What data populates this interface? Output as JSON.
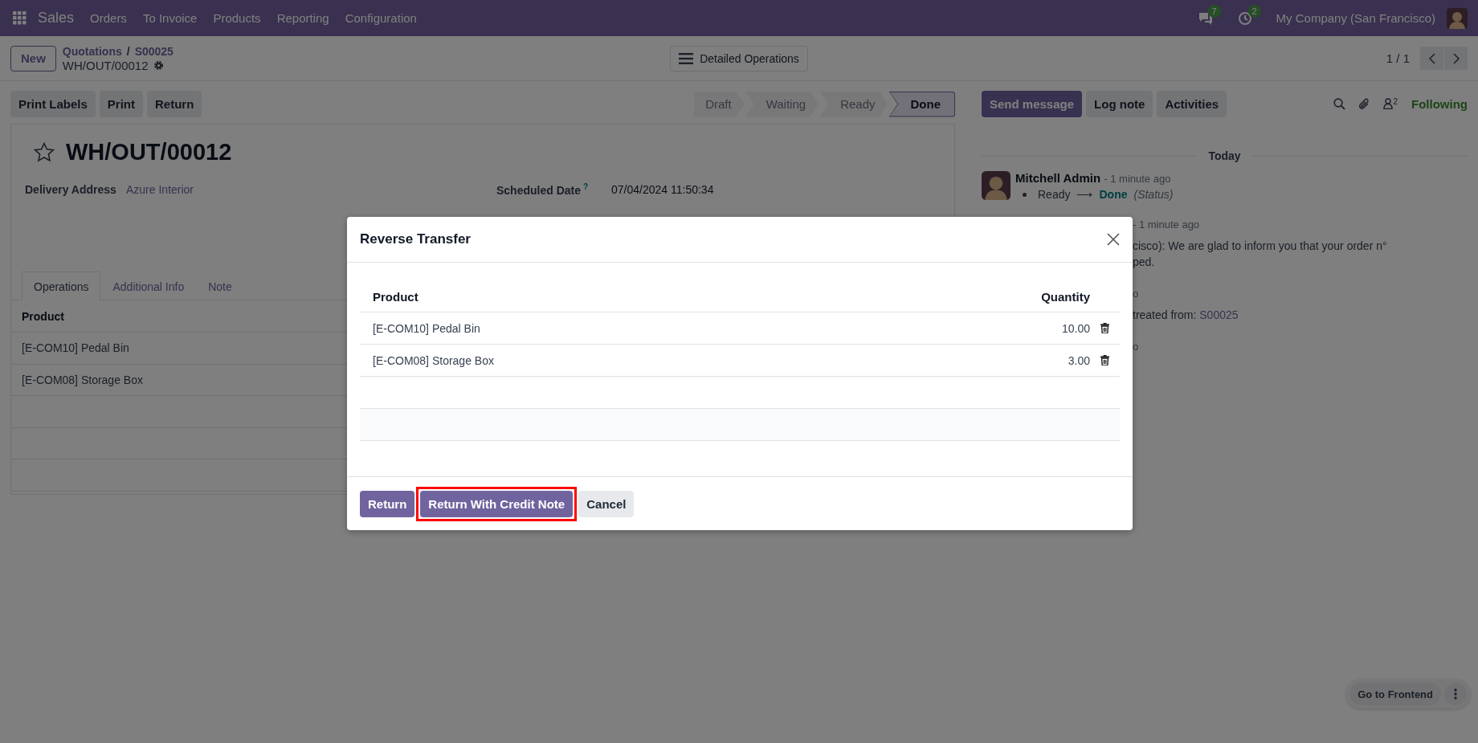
{
  "navbar": {
    "app": "Sales",
    "menu": [
      "Orders",
      "To Invoice",
      "Products",
      "Reporting",
      "Configuration"
    ],
    "messages_badge": "7",
    "activities_badge": "2",
    "company": "My Company (San Francisco)"
  },
  "control_panel": {
    "new_button": "New",
    "breadcrumbs": [
      "Quotations",
      "S00025"
    ],
    "breadcrumb_separator": "/",
    "record": "WH/OUT/00012",
    "view_button": "Detailed Operations",
    "pager": "1 / 1"
  },
  "actions": [
    "Print Labels",
    "Print",
    "Return"
  ],
  "statusbar": [
    {
      "label": "Draft",
      "selected": false
    },
    {
      "label": "Waiting",
      "selected": false
    },
    {
      "label": "Ready",
      "selected": false
    },
    {
      "label": "Done",
      "selected": true
    }
  ],
  "form": {
    "starred": false,
    "title": "WH/OUT/00012",
    "left_fields": [
      {
        "label": "Delivery Address",
        "value": "Azure Interior",
        "kind": "link"
      }
    ],
    "right_fields": [
      {
        "label": "Scheduled Date",
        "help": "?",
        "value": "07/04/2024 11:50:34",
        "kind": "text"
      }
    ],
    "tabs": [
      {
        "label": "Operations",
        "selected": true
      },
      {
        "label": "Additional Info",
        "selected": false
      },
      {
        "label": "Note",
        "selected": false
      }
    ],
    "list": {
      "columns": [
        "Product"
      ],
      "rows": [
        [
          "[E-COM10] Pedal Bin"
        ],
        [
          "[E-COM08] Storage Box"
        ]
      ]
    }
  },
  "chatter": {
    "buttons": [
      {
        "label": "Send message",
        "kind": "primary"
      },
      {
        "label": "Log note",
        "kind": "secondary"
      },
      {
        "label": "Activities",
        "kind": "secondary"
      }
    ],
    "follower_count": "2",
    "follow_label": "Following",
    "separator": "Today",
    "messages": [
      {
        "kind": "full",
        "author": "Mitchell Admin",
        "time": "- 1 minute ago",
        "old_value": "Ready",
        "arrow": "⟶",
        "new_value": "Done",
        "field": "(Status)"
      },
      {
        "kind": "partial",
        "lines": [
          {
            "kind": "meta",
            "text": "- 1 minute ago"
          },
          {
            "kind": "body",
            "text": "cisco): We are glad to inform you that your order n°"
          },
          {
            "kind": "body",
            "text": "ped."
          }
        ]
      },
      {
        "kind": "partial",
        "lines": [
          {
            "kind": "meta",
            "text": "o"
          },
          {
            "kind": "body",
            "text": "treated from: ",
            "link": "S00025"
          }
        ]
      },
      {
        "kind": "partial",
        "lines": [
          {
            "kind": "meta",
            "text": "o"
          }
        ]
      }
    ]
  },
  "dialog": {
    "title": "Reverse Transfer",
    "columns": [
      "Product",
      "Quantity"
    ],
    "rows": [
      {
        "product": "[E-COM10] Pedal Bin",
        "quantity": "10.00"
      },
      {
        "product": "[E-COM08] Storage Box",
        "quantity": "3.00"
      }
    ],
    "buttons": [
      {
        "label": "Return",
        "kind": "primary",
        "highlighted": false
      },
      {
        "label": "Return With Credit Note",
        "kind": "primary",
        "highlighted": true
      },
      {
        "label": "Cancel",
        "kind": "secondary",
        "highlighted": false
      }
    ]
  },
  "frontend_button": "Go to Frontend"
}
